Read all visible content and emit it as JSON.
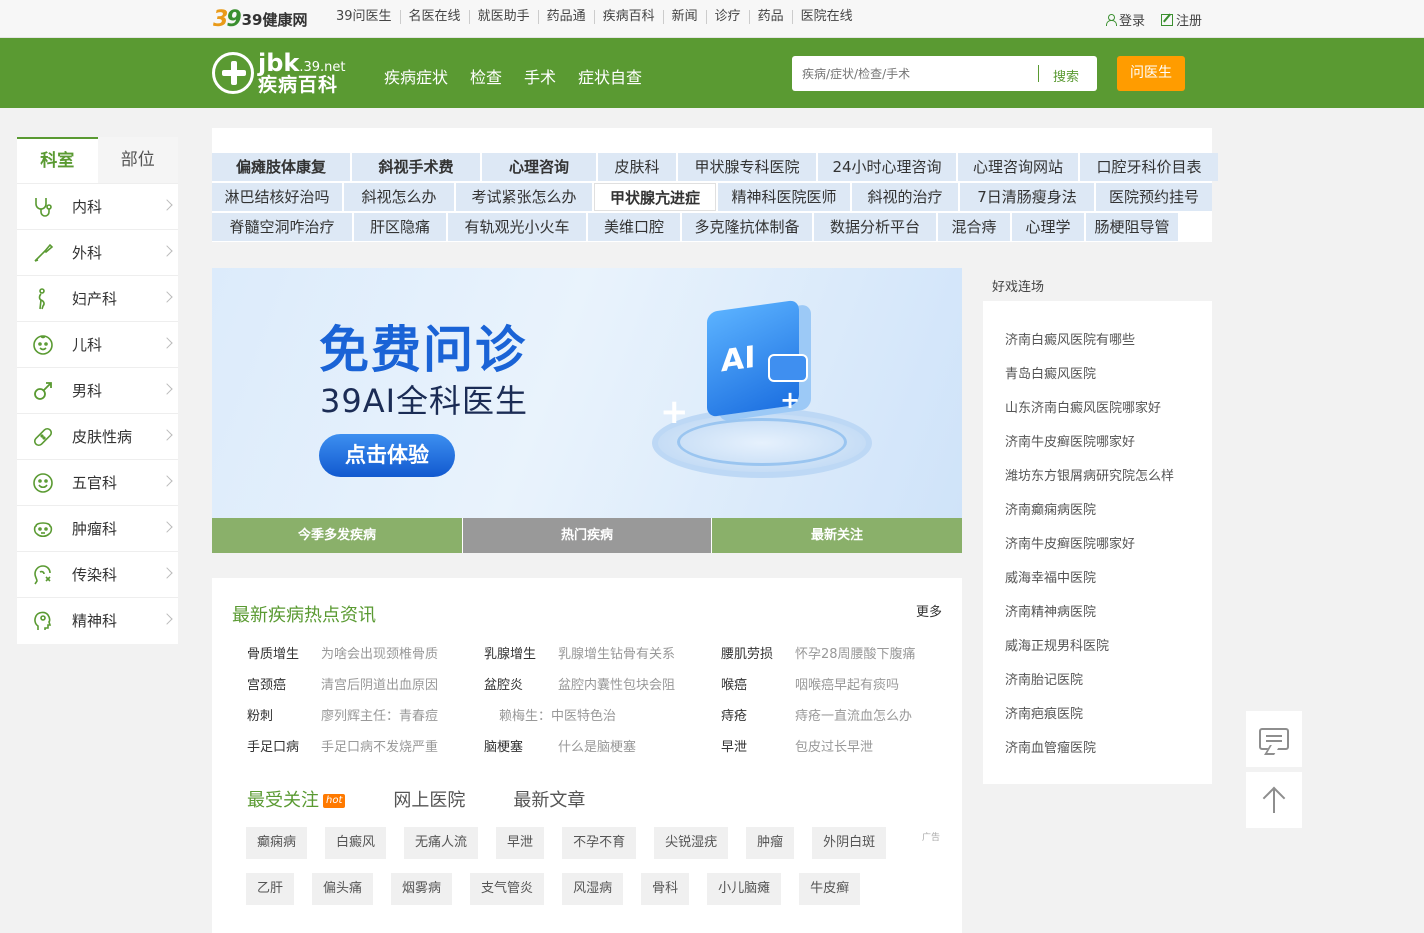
{
  "topbar": {
    "logo_num": "39",
    "logo_text": "39健康网",
    "nav": [
      "39问医生",
      "名医在线",
      "就医助手",
      "药品通",
      "疾病百科",
      "新闻",
      "诊疗",
      "药品",
      "医院在线"
    ],
    "login": "登录",
    "register": "注册"
  },
  "header": {
    "logo_main": "jbk",
    "logo_domain": ".39.net",
    "logo_sub": "疾病百科",
    "nav": [
      "疾病症状",
      "检查",
      "手术",
      "症状自查"
    ],
    "search_placeholder": "疾病/症状/检查/手术",
    "search_button": "搜索",
    "ask_button": "问医生"
  },
  "sidebar": {
    "tabs": [
      "科室",
      "部位"
    ],
    "items": [
      {
        "label": "内科",
        "icon": "stethoscope-icon"
      },
      {
        "label": "外科",
        "icon": "scalpel-icon"
      },
      {
        "label": "妇产科",
        "icon": "pregnant-icon"
      },
      {
        "label": "儿科",
        "icon": "baby-face-icon"
      },
      {
        "label": "男科",
        "icon": "male-icon"
      },
      {
        "label": "皮肤性病",
        "icon": "bandage-icon"
      },
      {
        "label": "五官科",
        "icon": "smile-face-icon"
      },
      {
        "label": "肿瘤科",
        "icon": "tumor-icon"
      },
      {
        "label": "传染科",
        "icon": "infection-icon"
      },
      {
        "label": "精神科",
        "icon": "head-brain-icon"
      }
    ]
  },
  "tag_rows": [
    [
      "偏瘫肢体康复",
      "斜视手术费",
      "心理咨询",
      "皮肤科",
      "甲状腺专科医院",
      "24小时心理咨询",
      "心理咨询网站",
      "口腔牙科价目表"
    ],
    [
      "淋巴结核好治吗",
      "斜视怎么办",
      "考试紧张怎么办",
      "甲状腺亢进症",
      "精神科医院医师",
      "斜视的治疗",
      "7日清肠瘦身法",
      "医院预约挂号"
    ],
    [
      "脊髓空洞咋治疗",
      "肝区隐痛",
      "有轨观光小火车",
      "美维口腔",
      "多克隆抗体制备",
      "数据分析平台",
      "混合痔",
      "心理学",
      "肠梗阻导管"
    ]
  ],
  "banner": {
    "headline": "免费问诊",
    "subline": "39AI全科医生",
    "cta": "点击体验",
    "box_label": "AI",
    "tabs": [
      "今季多发疾病",
      "热门疾病",
      "最新关注"
    ]
  },
  "news": {
    "title": "最新疾病热点资讯",
    "more": "更多",
    "rows": [
      [
        {
          "k": "骨质增生",
          "v": "为啥会出现颈椎骨质"
        },
        {
          "k": "乳腺增生",
          "v": "乳腺增生钻骨有关系"
        },
        {
          "k": "腰肌劳损",
          "v": "怀孕28周腰酸下腹痛"
        }
      ],
      [
        {
          "k": "宫颈癌",
          "v": "清宫后阴道出血原因"
        },
        {
          "k": "盆腔炎",
          "v": "盆腔内囊性包块会阻"
        },
        {
          "k": "喉癌",
          "v": "咽喉癌早起有痰吗"
        }
      ],
      [
        {
          "k": "粉刺",
          "v": "廖列辉主任：青春痘"
        },
        {
          "k": "",
          "v": "赖梅生：中医特色治"
        },
        {
          "k": "痔疮",
          "v": "痔疮一直流血怎么办"
        }
      ],
      [
        {
          "k": "手足口病",
          "v": "手足口病不发烧严重"
        },
        {
          "k": "脑梗塞",
          "v": "什么是脑梗塞"
        },
        {
          "k": "早泄",
          "v": "包皮过长早泄"
        }
      ]
    ],
    "tabs": [
      "最受关注",
      "网上医院",
      "最新文章"
    ],
    "hot_badge": "hot",
    "ad_label": "广告",
    "chips_row1": [
      "癫痫病",
      "白癜风",
      "无痛人流",
      "早泄",
      "不孕不育",
      "尖锐湿疣",
      "肿瘤",
      "外阴白斑"
    ],
    "chips_row2": [
      "乙肝",
      "偏头痛",
      "烟雾病",
      "支气管炎",
      "风湿病",
      "骨科",
      "小儿脑瘫",
      "牛皮癣"
    ]
  },
  "right": {
    "title": "好戏连场",
    "items": [
      "济南白癜风医院有哪些",
      "青岛白癜风医院",
      "山东济南白癜风医院哪家好",
      "济南牛皮癣医院哪家好",
      "潍坊东方银屑病研究院怎么样",
      "济南癫痫病医院",
      "济南牛皮癣医院哪家好",
      "威海幸福中医院",
      "济南精神病医院",
      "威海正规男科医院",
      "济南胎记医院",
      "济南疤痕医院",
      "济南血管瘤医院"
    ]
  },
  "colors": {
    "brand_green": "#5a9a32",
    "orange": "#ff9c00",
    "tag_bg": "#dde8f5"
  }
}
